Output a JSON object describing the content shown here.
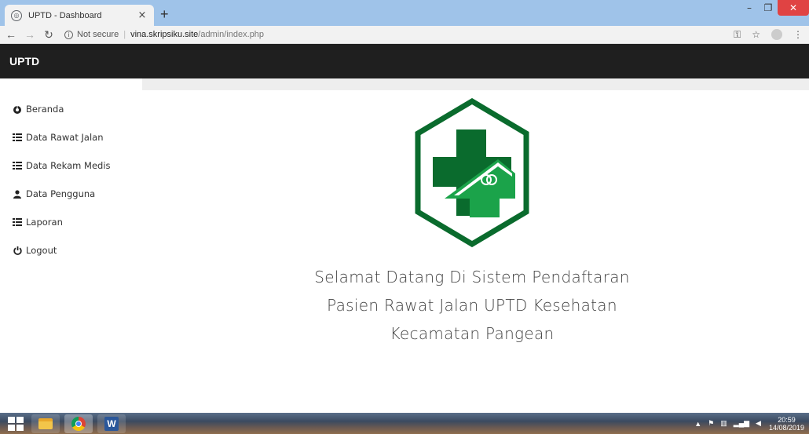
{
  "browser": {
    "tab_title": "UPTD - Dashboard",
    "tab_close": "×",
    "new_tab": "+",
    "security_label": "Not secure",
    "url_domain": "vina.skripsiku.site",
    "url_path": "/admin/index.php",
    "window_controls": {
      "minimize": "–",
      "maximize": "❐",
      "close": "✕"
    }
  },
  "navbar": {
    "brand": "UPTD"
  },
  "sidebar": {
    "items": [
      {
        "label": "Beranda",
        "icon": "dashboard-icon"
      },
      {
        "label": "Data Rawat Jalan",
        "icon": "list-icon"
      },
      {
        "label": "Data Rekam Medis",
        "icon": "list-icon"
      },
      {
        "label": "Data Pengguna",
        "icon": "user-icon"
      },
      {
        "label": "Laporan",
        "icon": "list-icon"
      },
      {
        "label": "Logout",
        "icon": "power-icon"
      }
    ]
  },
  "main": {
    "welcome_lines": [
      "Selamat Datang Di Sistem Pendaftaran",
      "Pasien Rawat Jalan UPTD Kesehatan",
      "Kecamatan Pangean"
    ]
  },
  "taskbar": {
    "apps": [
      "windows-explorer",
      "chrome",
      "word"
    ],
    "clock_time": "20:59",
    "clock_date": "14/08/2019"
  },
  "colors": {
    "navbar_bg": "#1f1f1f",
    "logo_green_dark": "#0a6b2d",
    "logo_green_light": "#1ba34a"
  }
}
